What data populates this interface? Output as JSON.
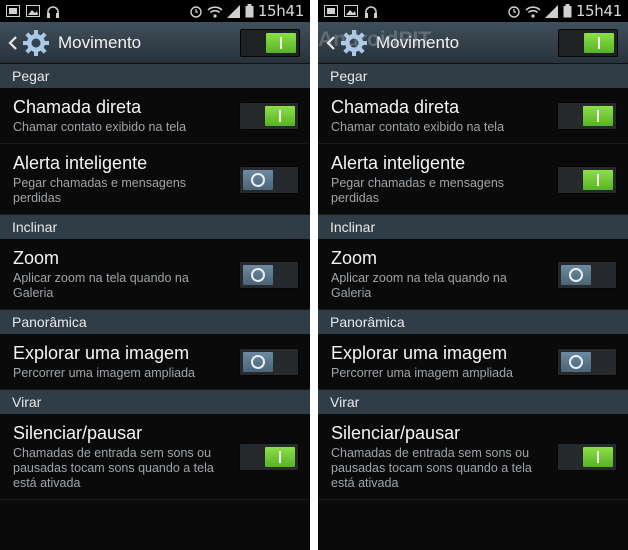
{
  "screens": [
    {
      "status": {
        "time": "15h41"
      },
      "header": {
        "title": "Movimento",
        "watermark": "",
        "master_on": true
      },
      "sections": [
        {
          "label": "Pegar",
          "items": [
            {
              "title": "Chamada direta",
              "subtitle": "Chamar contato exibido na tela",
              "on": true
            },
            {
              "title": "Alerta inteligente",
              "subtitle": "Pegar chamadas e mensagens perdidas",
              "on": false
            }
          ]
        },
        {
          "label": "Inclinar",
          "items": [
            {
              "title": "Zoom",
              "subtitle": "Aplicar zoom na tela quando na Galeria",
              "on": false
            }
          ]
        },
        {
          "label": "Panorâmica",
          "items": [
            {
              "title": "Explorar uma imagem",
              "subtitle": "Percorrer uma imagem ampliada",
              "on": false
            }
          ]
        },
        {
          "label": "Virar",
          "items": [
            {
              "title": "Silenciar/pausar",
              "subtitle": "Chamadas de entrada sem sons ou pausadas tocam sons quando a tela está ativada",
              "on": true
            }
          ]
        }
      ]
    },
    {
      "status": {
        "time": "15h41"
      },
      "header": {
        "title": "Movimento",
        "watermark": "AndroidPIT",
        "master_on": true
      },
      "sections": [
        {
          "label": "Pegar",
          "items": [
            {
              "title": "Chamada direta",
              "subtitle": "Chamar contato exibido na tela",
              "on": true
            },
            {
              "title": "Alerta inteligente",
              "subtitle": "Pegar chamadas e mensagens perdidas",
              "on": true
            }
          ]
        },
        {
          "label": "Inclinar",
          "items": [
            {
              "title": "Zoom",
              "subtitle": "Aplicar zoom na tela quando na Galeria",
              "on": false
            }
          ]
        },
        {
          "label": "Panorâmica",
          "items": [
            {
              "title": "Explorar uma imagem",
              "subtitle": "Percorrer uma imagem ampliada",
              "on": false
            }
          ]
        },
        {
          "label": "Virar",
          "items": [
            {
              "title": "Silenciar/pausar",
              "subtitle": "Chamadas de entrada sem sons ou pausadas tocam sons quando a tela está ativada",
              "on": true
            }
          ]
        }
      ]
    }
  ],
  "colors": {
    "toggle_on": "#6cc832",
    "toggle_off": "#5a7588",
    "section_bg": "#303d47",
    "actionbar": "#34414c"
  },
  "icons": [
    "gallery-icon",
    "image-icon",
    "headphones-icon",
    "alarm-icon",
    "wifi-icon",
    "signal-icon",
    "battery-icon",
    "back-arrow-icon",
    "gear-icon"
  ]
}
